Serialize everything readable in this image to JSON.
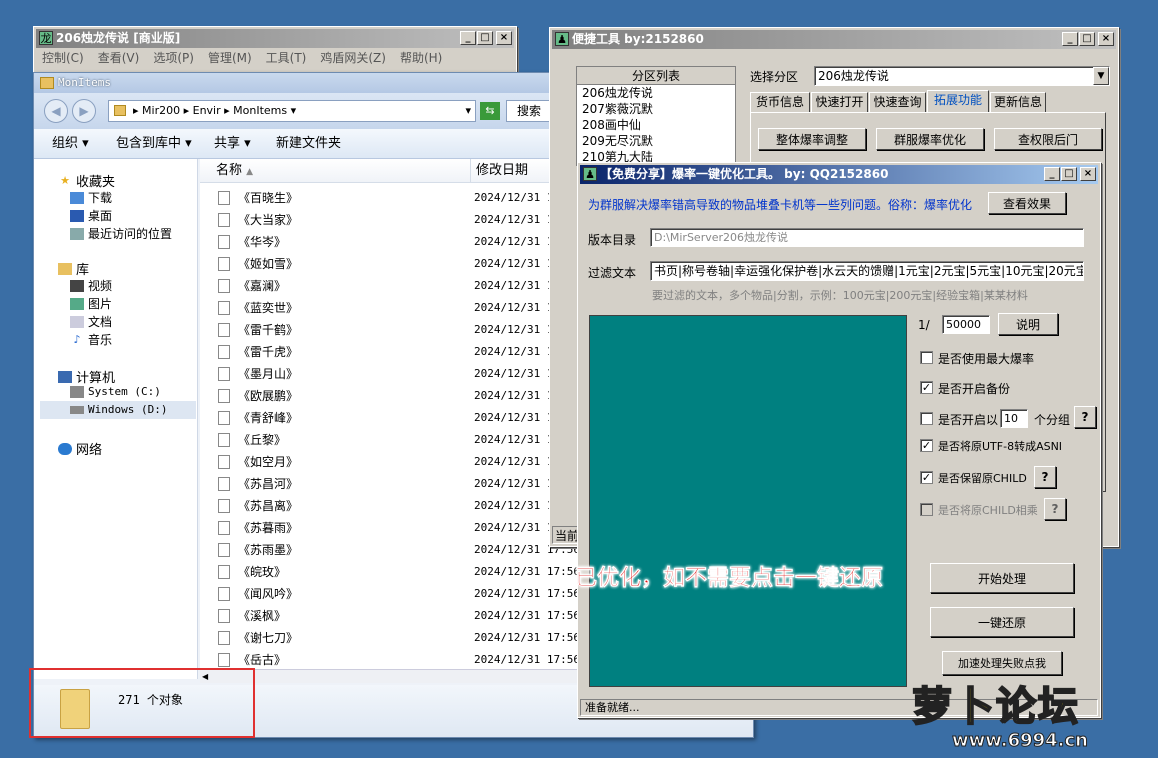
{
  "main_window": {
    "title": "206烛龙传说 [商业版]",
    "menu": [
      "控制(C)",
      "查看(V)",
      "选项(P)",
      "管理(M)",
      "工具(T)",
      "鸡盾网关(Z)",
      "帮助(H)"
    ]
  },
  "explorer": {
    "title": "MonItems",
    "breadcrumb": [
      "Mir200",
      "Envir",
      "MonItems"
    ],
    "search_placeholder": "搜索",
    "toolbar": [
      "组织",
      "包含到库中",
      "共享",
      "新建文件夹"
    ],
    "sidebar": {
      "favorites": "收藏夹",
      "fav_items": [
        "下载",
        "桌面",
        "最近访问的位置"
      ],
      "library": "库",
      "lib_items": [
        "视频",
        "图片",
        "文档",
        "音乐"
      ],
      "computer": "计算机",
      "drives": [
        "System (C:)",
        "Windows (D:)"
      ],
      "network": "网络"
    },
    "columns": {
      "name": "名称",
      "date": "修改日期"
    },
    "files": [
      {
        "name": "《百晓生》",
        "date": "2024/12/31 1"
      },
      {
        "name": "《大当家》",
        "date": "2024/12/31 1"
      },
      {
        "name": "《华岑》",
        "date": "2024/12/31 1"
      },
      {
        "name": "《姬如雪》",
        "date": "2024/12/31 1"
      },
      {
        "name": "《嘉澜》",
        "date": "2024/12/31 1"
      },
      {
        "name": "《蓝奕世》",
        "date": "2024/12/31 1"
      },
      {
        "name": "《雷千鹤》",
        "date": "2024/12/31 1"
      },
      {
        "name": "《雷千虎》",
        "date": "2024/12/31 1"
      },
      {
        "name": "《墨月山》",
        "date": "2024/12/31 1"
      },
      {
        "name": "《欧展鹏》",
        "date": "2024/12/31 1"
      },
      {
        "name": "《青舒峰》",
        "date": "2024/12/31 1"
      },
      {
        "name": "《丘黎》",
        "date": "2024/12/31 1"
      },
      {
        "name": "《如空月》",
        "date": "2024/12/31 1"
      },
      {
        "name": "《苏昌河》",
        "date": "2024/12/31 1"
      },
      {
        "name": "《苏昌离》",
        "date": "2024/12/31 1"
      },
      {
        "name": "《苏暮雨》",
        "date": "2024/12/31 1"
      },
      {
        "name": "《苏雨墨》",
        "date": "2024/12/31 17:56"
      },
      {
        "name": "《皖玫》",
        "date": "2024/12/31 17:56"
      },
      {
        "name": "《闻风吟》",
        "date": "2024/12/31 17:56"
      },
      {
        "name": "《溪枫》",
        "date": "2024/12/31 17:56"
      },
      {
        "name": "《谢七刀》",
        "date": "2024/12/31 17:56"
      },
      {
        "name": "《岳古》",
        "date": "2024/12/31 17:56"
      }
    ],
    "status_count": "271 个对象"
  },
  "quick_tool": {
    "title": "便捷工具  by:2152860",
    "server_list_header": "分区列表",
    "servers": [
      "206烛龙传说",
      "207紫薇沉默",
      "208画中仙",
      "209无尽沉默",
      "210第九大陆"
    ],
    "select_label": "选择分区",
    "selected_server": "206烛龙传说",
    "tabs": [
      "货币信息",
      "快速打开",
      "快速查询",
      "拓展功能",
      "更新信息"
    ],
    "buttons": [
      "整体爆率调整",
      "群服爆率优化",
      "查权限后门"
    ],
    "status_prefix": "当前"
  },
  "opt_tool": {
    "title": "【免费分享】爆率一键优化工具。  by: QQ2152860",
    "description": "为群服解决爆率错高导致的物品堆叠卡机等一些列问题。俗称：爆率优化",
    "view_effect": "查看效果",
    "version_dir_label": "版本目录",
    "version_dir_value": "D:\\MirServer206烛龙传说",
    "filter_label": "过滤文本",
    "filter_value": "书页|称号卷轴|幸运强化保护卷|水云天的馈赠|1元宝|2元宝|5元宝|10元宝|20元宝",
    "filter_hint": "要过滤的文本，多个物品|分割，示例：100元宝|200元宝|经验宝箱|某某材料",
    "ratio_prefix": "1/",
    "ratio_value": "50000",
    "explain_button": "说明",
    "options": [
      {
        "label": "是否使用最大爆率",
        "checked": false,
        "enabled": true
      },
      {
        "label": "是否开启备份",
        "checked": true,
        "enabled": true
      },
      {
        "label": "是否开启以",
        "checked": false,
        "enabled": true
      },
      {
        "label": "是否将原UTF-8转成ASNI",
        "checked": true,
        "enabled": true
      },
      {
        "label": "是否保留原CHILD",
        "checked": true,
        "enabled": true
      },
      {
        "label": "是否将原CHILD相乘",
        "checked": false,
        "enabled": false
      }
    ],
    "group_value": "10",
    "group_suffix": "个分组",
    "help": "?",
    "start_button": "开始处理",
    "restore_button": "一键还原",
    "join_button": "加速处理失败点我",
    "status": "准备就绪..."
  },
  "annotation": "已优化，如不需要点击一键还原",
  "watermark": {
    "text": "萝卜论坛",
    "url": "www.6994.cn"
  },
  "colors": {
    "desktop": "#3a6ea5",
    "teal_panel": "#008080",
    "annotation_red": "#e01010",
    "highlight_box": "#e03030"
  }
}
